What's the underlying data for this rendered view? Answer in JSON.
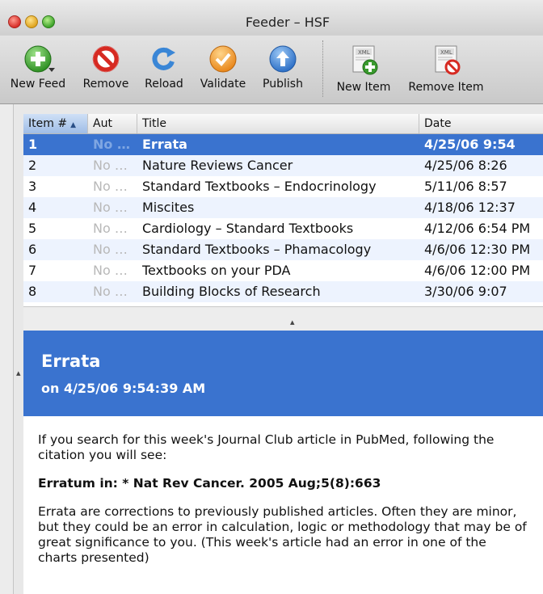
{
  "window": {
    "title": "Feeder – HSF"
  },
  "toolbar": {
    "buttons": [
      {
        "label": "New Feed",
        "icon": "new-feed-icon"
      },
      {
        "label": "Remove",
        "icon": "remove-icon"
      },
      {
        "label": "Reload",
        "icon": "reload-icon"
      },
      {
        "label": "Validate",
        "icon": "validate-icon"
      },
      {
        "label": "Publish",
        "icon": "publish-icon"
      },
      {
        "label": "New Item",
        "icon": "new-item-icon"
      },
      {
        "label": "Remove Item",
        "icon": "remove-item-icon"
      }
    ]
  },
  "table": {
    "columns": [
      "Item #",
      "Aut",
      "Title",
      "Date"
    ],
    "sorted_column": "Item #",
    "rows": [
      {
        "num": "1",
        "aut": "No …",
        "title": "Errata",
        "date": "4/25/06 9:54",
        "selected": true
      },
      {
        "num": "2",
        "aut": "No …",
        "title": "Nature Reviews Cancer",
        "date": "4/25/06 8:26"
      },
      {
        "num": "3",
        "aut": "No …",
        "title": "Standard Textbooks – Endocrinology",
        "date": "5/11/06 8:57"
      },
      {
        "num": "4",
        "aut": "No …",
        "title": "Miscites",
        "date": "4/18/06 12:37"
      },
      {
        "num": "5",
        "aut": "No …",
        "title": "Cardiology – Standard Textbooks",
        "date": "4/12/06 6:54 PM"
      },
      {
        "num": "6",
        "aut": "No …",
        "title": "Standard Textbooks – Phamacology",
        "date": "4/6/06 12:30 PM"
      },
      {
        "num": "7",
        "aut": "No …",
        "title": "Textbooks on your PDA",
        "date": "4/6/06 12:00 PM"
      },
      {
        "num": "8",
        "aut": "No …",
        "title": "Building Blocks of Research",
        "date": "3/30/06 9:07"
      }
    ]
  },
  "preview": {
    "title": "Errata",
    "date": "on 4/25/06 9:54:39 AM",
    "para1": "If you search for this week's Journal Club article in PubMed, following the citation you will see:",
    "para2": "Erratum in: * Nat Rev Cancer. 2005 Aug;5(8):663",
    "para3": "Errata are corrections to previously published articles. Often they are minor, but they could be an error in calculation, logic or methodology that may be of great significance to you. (This week's article had an error in one of the charts presented)"
  },
  "colors": {
    "selection": "#3a73cf",
    "alt_row": "#edf3fe"
  }
}
